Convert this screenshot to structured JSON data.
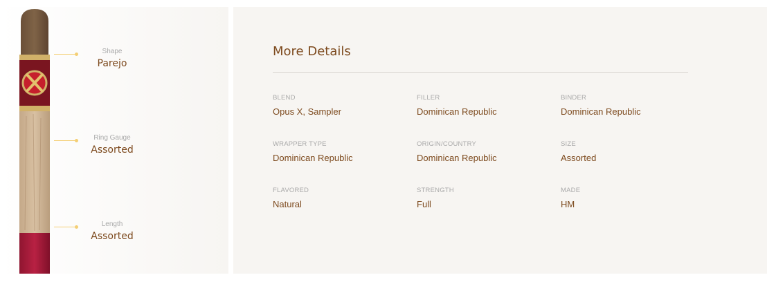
{
  "specs": {
    "shape": {
      "label": "Shape",
      "value": "Parejo"
    },
    "ring_gauge": {
      "label": "Ring Gauge",
      "value": "Assorted"
    },
    "length": {
      "label": "Length",
      "value": "Assorted"
    }
  },
  "details": {
    "title": "More Details",
    "items": [
      {
        "label": "BLEND",
        "value": "Opus X, Sampler"
      },
      {
        "label": "FILLER",
        "value": "Dominican Republic"
      },
      {
        "label": "BINDER",
        "value": "Dominican Republic"
      },
      {
        "label": "WRAPPER TYPE",
        "value": "Dominican Republic"
      },
      {
        "label": "ORIGIN/COUNTRY",
        "value": "Dominican Republic"
      },
      {
        "label": "SIZE",
        "value": "Assorted"
      },
      {
        "label": "FLAVORED",
        "value": "Natural"
      },
      {
        "label": "STRENGTH",
        "value": "Full"
      },
      {
        "label": "MADE",
        "value": "HM"
      }
    ]
  },
  "colors": {
    "accent": "#7d4a1e",
    "connector": "#f4cf74",
    "panel_bg": "#f7f5f2"
  }
}
